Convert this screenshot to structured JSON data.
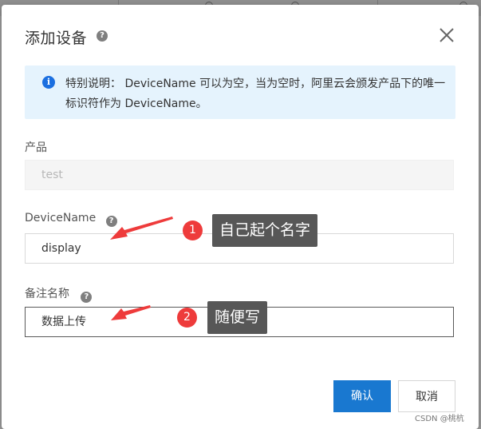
{
  "dialog": {
    "title": "添加设备",
    "help_glyph": "?",
    "close_icon": "close-icon"
  },
  "notice": {
    "icon_glyph": "i",
    "text": "特别说明： DeviceName 可以为空，当为空时，阿里云会颁发产品下的唯一标识符作为 DeviceName。"
  },
  "fields": {
    "product": {
      "label": "产品",
      "value": "test"
    },
    "device_name": {
      "label": "DeviceName",
      "value": "display"
    },
    "remark": {
      "label": "备注名称",
      "value": "数据上传"
    }
  },
  "callouts": [
    {
      "number": "1",
      "text": "自己起个名字"
    },
    {
      "number": "2",
      "text": "随便写"
    }
  ],
  "buttons": {
    "confirm": "确认",
    "cancel": "取消"
  },
  "watermark": "CSDN @桃杭",
  "colors": {
    "primary": "#1978d0",
    "notice_bg": "#e5f3fd",
    "callout_red": "#ee3b3b",
    "callout_box": "#575757"
  }
}
